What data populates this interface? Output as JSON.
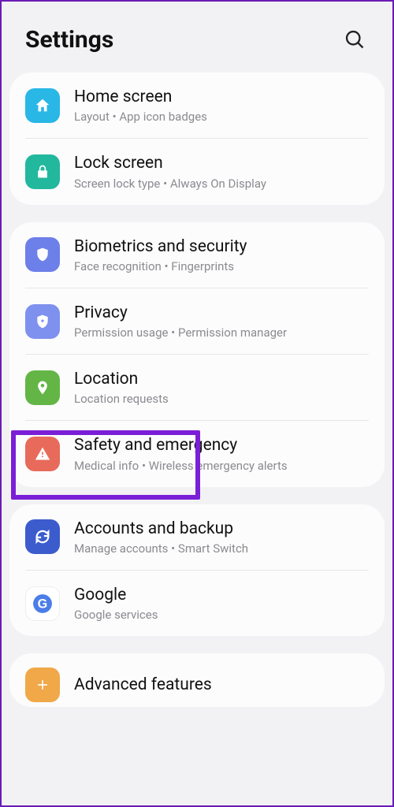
{
  "header": {
    "title": "Settings"
  },
  "groups": [
    {
      "items": [
        {
          "title": "Home screen",
          "sub": "Layout  •  App icon badges",
          "icon": "home",
          "color": "#29b7e6"
        },
        {
          "title": "Lock screen",
          "sub": "Screen lock type  •  Always On Display",
          "icon": "lock",
          "color": "#22b89d"
        }
      ]
    },
    {
      "items": [
        {
          "title": "Biometrics and security",
          "sub": "Face recognition  •  Fingerprints",
          "icon": "shield",
          "color": "#6d7fe8"
        },
        {
          "title": "Privacy",
          "sub": "Permission usage  •  Permission manager",
          "icon": "privacy",
          "color": "#7f91ee"
        },
        {
          "title": "Location",
          "sub": "Location requests",
          "icon": "location",
          "color": "#63b646"
        },
        {
          "title": "Safety and emergency",
          "sub": "Medical info  •  Wireless emergency alerts",
          "icon": "alert",
          "color": "#e86a5a"
        }
      ]
    },
    {
      "items": [
        {
          "title": "Accounts and backup",
          "sub": "Manage accounts  •  Smart Switch",
          "icon": "sync",
          "color": "#3c5ccd"
        },
        {
          "title": "Google",
          "sub": "Google services",
          "icon": "google",
          "color": "#ffffff"
        }
      ]
    },
    {
      "items": [
        {
          "title": "Advanced features",
          "sub": "",
          "icon": "plus",
          "color": "#f0a848"
        }
      ]
    }
  ]
}
